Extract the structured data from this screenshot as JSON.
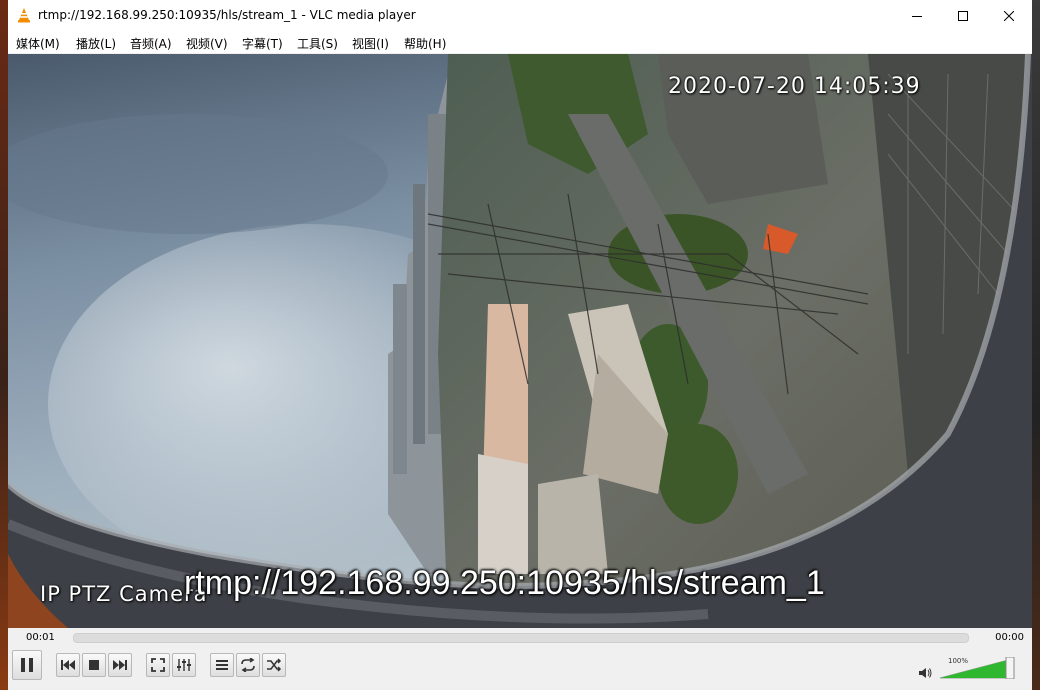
{
  "window": {
    "title": "rtmp://192.168.99.250:10935/hls/stream_1 - VLC media player",
    "buttons": [
      "minimize-icon",
      "maximize-icon",
      "close-icon"
    ]
  },
  "menu": [
    {
      "label": "媒体(M)"
    },
    {
      "label": "播放(L)"
    },
    {
      "label": "音频(A)"
    },
    {
      "label": "视频(V)"
    },
    {
      "label": "字幕(T)"
    },
    {
      "label": "工具(S)"
    },
    {
      "label": "视图(I)"
    },
    {
      "label": "帮助(H)"
    }
  ],
  "video": {
    "timestamp": "2020-07-20 14:05:39",
    "camera_label": "IP PTZ Camera",
    "stream_url": "rtmp://192.168.99.250:10935/hls/stream_1"
  },
  "playback": {
    "elapsed": "00:01",
    "total": "00:00",
    "progress_fraction": 0.0
  },
  "controls": {
    "icons": [
      "pause-icon",
      "previous-icon",
      "stop-icon",
      "next-icon",
      "fullscreen-icon",
      "extended-settings-icon",
      "playlist-icon",
      "loop-icon",
      "shuffle-icon",
      "volume-icon"
    ]
  },
  "volume": {
    "label": "100%",
    "level_fraction": 1.0
  },
  "colors": {
    "vlc_orange": "#f28c00",
    "volume_green": "#2fb82f"
  }
}
